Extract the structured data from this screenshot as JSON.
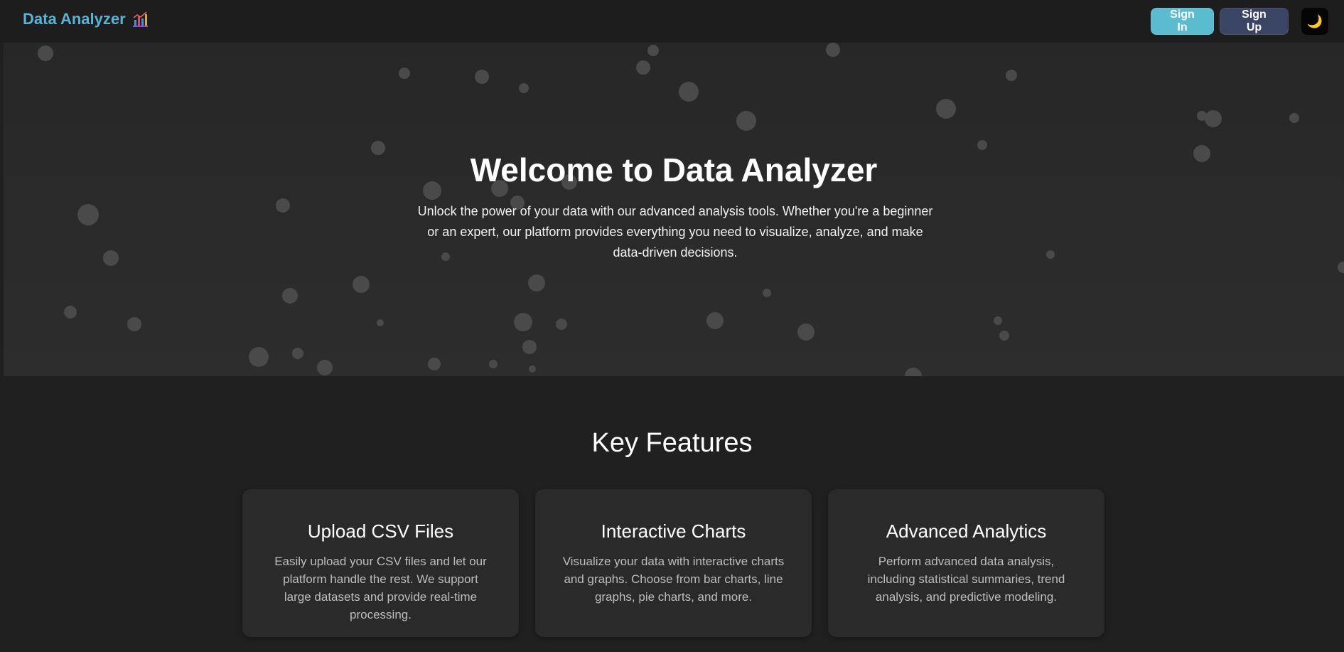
{
  "navbar": {
    "brand": "Data Analyzer",
    "brand_icon": "bar-chart-icon",
    "signin_label": "Sign In",
    "signup_label": "Sign Up",
    "theme_icon": "🌙",
    "colors": {
      "brand": "#5ab3d6",
      "signin_bg": "#5bbccf",
      "signup_bg": "#3a4566"
    }
  },
  "hero": {
    "title": "Welcome to Data Analyzer",
    "description": "Unlock the power of your data with our advanced analysis tools. Whether you're a beginner or an expert, our platform provides everything you need to visualize, analyze, and make data-driven decisions."
  },
  "features": {
    "title": "Key Features",
    "cards": [
      {
        "title": "Upload CSV Files",
        "text": "Easily upload your CSV files and let our platform handle the rest. We support large datasets and provide real-time processing."
      },
      {
        "title": "Interactive Charts",
        "text": "Visualize your data with interactive charts and graphs. Choose from bar charts, line graphs, pie charts, and more."
      },
      {
        "title": "Advanced Analytics",
        "text": "Perform advanced data analysis, including statistical summaries, trend analysis, and predictive modeling."
      }
    ]
  }
}
